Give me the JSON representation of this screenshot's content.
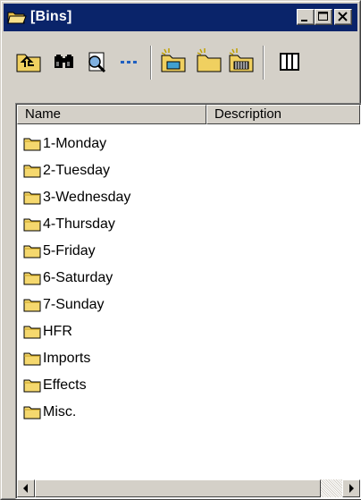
{
  "window": {
    "title": "[Bins]",
    "title_icon": "folder-open-icon",
    "controls": [
      "minimize-icon",
      "maximize-icon",
      "close-icon"
    ]
  },
  "toolbar": {
    "buttons": [
      {
        "name": "up-one-level-icon"
      },
      {
        "name": "find-icon"
      },
      {
        "name": "search-document-icon"
      },
      {
        "name": "details-dots-icon"
      },
      {
        "name": "new-bin-clip-icon"
      },
      {
        "name": "new-bin-icon"
      },
      {
        "name": "new-bin-sequence-icon"
      },
      {
        "name": "column-view-icon"
      }
    ]
  },
  "list": {
    "columns": [
      "Name",
      "Description"
    ],
    "items": [
      {
        "label": "1-Monday"
      },
      {
        "label": "2-Tuesday"
      },
      {
        "label": "3-Wednesday"
      },
      {
        "label": "4-Thursday"
      },
      {
        "label": "5-Friday"
      },
      {
        "label": "6-Saturday"
      },
      {
        "label": "7-Sunday"
      },
      {
        "label": "HFR"
      },
      {
        "label": "Imports"
      },
      {
        "label": "Effects"
      },
      {
        "label": "Misc."
      }
    ]
  },
  "colors": {
    "titlebar": "#0a246a",
    "face": "#d4d0c8",
    "folder": "#f5d86e"
  }
}
